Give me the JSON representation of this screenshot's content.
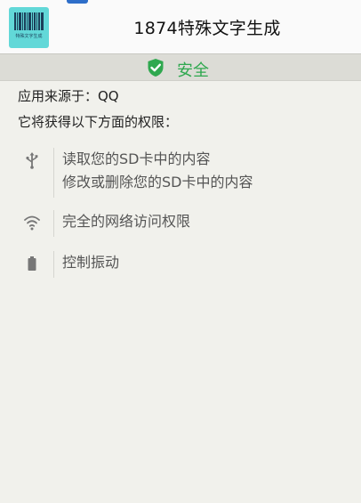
{
  "app": {
    "title": "1874特殊文字生成",
    "icon_name": "barcode-app-icon",
    "icon_caption": "特殊文字生成"
  },
  "security": {
    "label": "安全",
    "icon": "shield-check-icon",
    "color": "#2fa84f"
  },
  "info": {
    "source": "应用来源于：QQ",
    "permissions_intro": "它将获得以下方面的权限："
  },
  "permissions": [
    {
      "icon": "usb-icon",
      "lines": [
        "读取您的SD卡中的内容",
        "修改或删除您的SD卡中的内容"
      ]
    },
    {
      "icon": "wifi-icon",
      "lines": [
        "完全的网络访问权限"
      ]
    },
    {
      "icon": "battery-icon",
      "lines": [
        "控制振动"
      ]
    }
  ]
}
